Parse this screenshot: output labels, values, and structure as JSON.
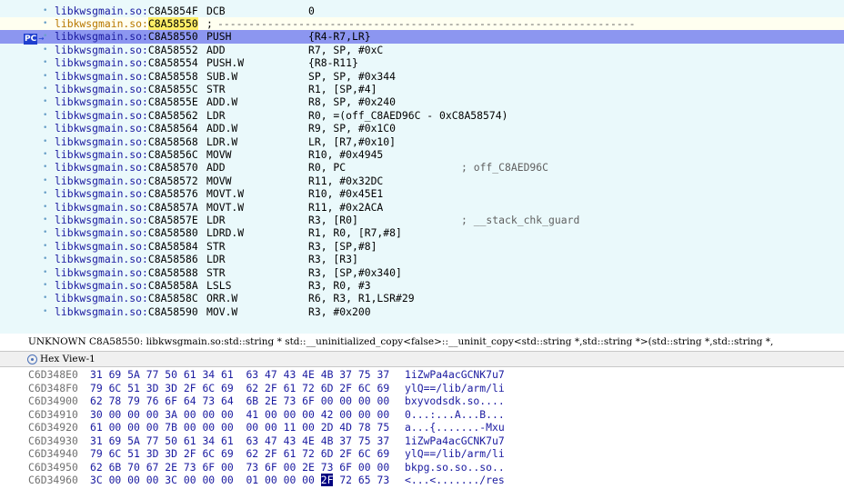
{
  "disasm": {
    "lines": [
      {
        "seg": "libkwsgmain.so:",
        "addr": "C8A5854F",
        "mnem": "DCB",
        "ops": "0",
        "cmt": ""
      },
      {
        "seg": "libkwsgmain.so:",
        "addr": "C8A58550",
        "mnem": ";",
        "ops": "",
        "cmt": "",
        "dashes": "-------------------------------------------------------------------"
      },
      {
        "seg": "libkwsgmain.so:",
        "addr": "C8A58550",
        "mnem": "PUSH",
        "ops": "{R4-R7,LR}",
        "cmt": ""
      },
      {
        "seg": "libkwsgmain.so:",
        "addr": "C8A58552",
        "mnem": "ADD",
        "ops": "R7, SP, #0xC",
        "cmt": ""
      },
      {
        "seg": "libkwsgmain.so:",
        "addr": "C8A58554",
        "mnem": "PUSH.W",
        "ops": "{R8-R11}",
        "cmt": ""
      },
      {
        "seg": "libkwsgmain.so:",
        "addr": "C8A58558",
        "mnem": "SUB.W",
        "ops": "SP, SP, #0x344",
        "cmt": ""
      },
      {
        "seg": "libkwsgmain.so:",
        "addr": "C8A5855C",
        "mnem": "STR",
        "ops": "R1, [SP,#4]",
        "cmt": ""
      },
      {
        "seg": "libkwsgmain.so:",
        "addr": "C8A5855E",
        "mnem": "ADD.W",
        "ops": "R8, SP, #0x240",
        "cmt": ""
      },
      {
        "seg": "libkwsgmain.so:",
        "addr": "C8A58562",
        "mnem": "LDR",
        "ops": "R0, =(off_C8AED96C - 0xC8A58574)",
        "cmt": ""
      },
      {
        "seg": "libkwsgmain.so:",
        "addr": "C8A58564",
        "mnem": "ADD.W",
        "ops": "R9, SP, #0x1C0",
        "cmt": ""
      },
      {
        "seg": "libkwsgmain.so:",
        "addr": "C8A58568",
        "mnem": "LDR.W",
        "ops": "LR, [R7,#0x10]",
        "cmt": ""
      },
      {
        "seg": "libkwsgmain.so:",
        "addr": "C8A5856C",
        "mnem": "MOVW",
        "ops": "R10, #0x4945",
        "cmt": ""
      },
      {
        "seg": "libkwsgmain.so:",
        "addr": "C8A58570",
        "mnem": "ADD",
        "ops": "R0, PC",
        "cmt": "; off_C8AED96C"
      },
      {
        "seg": "libkwsgmain.so:",
        "addr": "C8A58572",
        "mnem": "MOVW",
        "ops": "R11, #0x32DC",
        "cmt": ""
      },
      {
        "seg": "libkwsgmain.so:",
        "addr": "C8A58576",
        "mnem": "MOVT.W",
        "ops": "R10, #0x45E1",
        "cmt": ""
      },
      {
        "seg": "libkwsgmain.so:",
        "addr": "C8A5857A",
        "mnem": "MOVT.W",
        "ops": "R11, #0x2ACA",
        "cmt": ""
      },
      {
        "seg": "libkwsgmain.so:",
        "addr": "C8A5857E",
        "mnem": "LDR",
        "ops": "R3, [R0]",
        "cmt": "; __stack_chk_guard"
      },
      {
        "seg": "libkwsgmain.so:",
        "addr": "C8A58580",
        "mnem": "LDRD.W",
        "ops": "R1, R0, [R7,#8]",
        "cmt": ""
      },
      {
        "seg": "libkwsgmain.so:",
        "addr": "C8A58584",
        "mnem": "STR",
        "ops": "R3, [SP,#8]",
        "cmt": ""
      },
      {
        "seg": "libkwsgmain.so:",
        "addr": "C8A58586",
        "mnem": "LDR",
        "ops": "R3, [R3]",
        "cmt": ""
      },
      {
        "seg": "libkwsgmain.so:",
        "addr": "C8A58588",
        "mnem": "STR",
        "ops": "R3, [SP,#0x340]",
        "cmt": ""
      },
      {
        "seg": "libkwsgmain.so:",
        "addr": "C8A5858A",
        "mnem": "LSLS",
        "ops": "R3, R0, #3",
        "cmt": ""
      },
      {
        "seg": "libkwsgmain.so:",
        "addr": "C8A5858C",
        "mnem": "ORR.W",
        "ops": "R6, R3, R1,LSR#29",
        "cmt": ""
      },
      {
        "seg": "libkwsgmain.so:",
        "addr": "C8A58590",
        "mnem": "MOV.W",
        "ops": "R3, #0x200",
        "cmt": ""
      }
    ],
    "pc_label": "PC",
    "pc_line": 2
  },
  "status_text": "UNKNOWN C8A58550: libkwsgmain.so:std::string * std::__uninitialized_copy<false>::__uninit_copy<std::string *,std::string *>(std::string *,std::string *,",
  "hex": {
    "title": "Hex View-1",
    "rows": [
      {
        "addr": "C6D348E0",
        "bytes": "31 69 5A 77 50 61 34 61  63 47 43 4E 4B 37 75 37",
        "ascii": "1iZwPa4acGCNK7u7"
      },
      {
        "addr": "C6D348F0",
        "bytes": "79 6C 51 3D 3D 2F 6C 69  62 2F 61 72 6D 2F 6C 69",
        "ascii": "ylQ==/lib/arm/li"
      },
      {
        "addr": "C6D34900",
        "bytes": "62 78 79 76 6F 64 73 64  6B 2E 73 6F 00 00 00 00",
        "ascii": "bxyvodsdk.so...."
      },
      {
        "addr": "C6D34910",
        "bytes": "30 00 00 00 3A 00 00 00  41 00 00 00 42 00 00 00",
        "ascii": "0...:...A...B..."
      },
      {
        "addr": "C6D34920",
        "bytes": "61 00 00 00 7B 00 00 00  00 00 11 00 2D 4D 78 75",
        "ascii": "a...{.......-Mxu"
      },
      {
        "addr": "C6D34930",
        "bytes": "31 69 5A 77 50 61 34 61  63 47 43 4E 4B 37 75 37",
        "ascii": "1iZwPa4acGCNK7u7"
      },
      {
        "addr": "C6D34940",
        "bytes": "79 6C 51 3D 3D 2F 6C 69  62 2F 61 72 6D 2F 6C 69",
        "ascii": "ylQ==/lib/arm/li"
      },
      {
        "addr": "C6D34950",
        "bytes": "62 6B 70 67 2E 73 6F 00  73 6F 00 2E 73 6F 00 00",
        "ascii": "bkpg.so.so..so.."
      },
      {
        "addr": "C6D34960",
        "bytes_pre": "3C 00 00 00 3C 00 00 00  01 00 00 00 ",
        "bytes_cur": "2F",
        "bytes_post": " 72 65 73",
        "ascii": "<...<......./res"
      }
    ]
  },
  "colors": {
    "disasm_bg": "#eaf9fb",
    "highlight": "#8c96f0",
    "pc_badge": "#1f3fcf"
  }
}
